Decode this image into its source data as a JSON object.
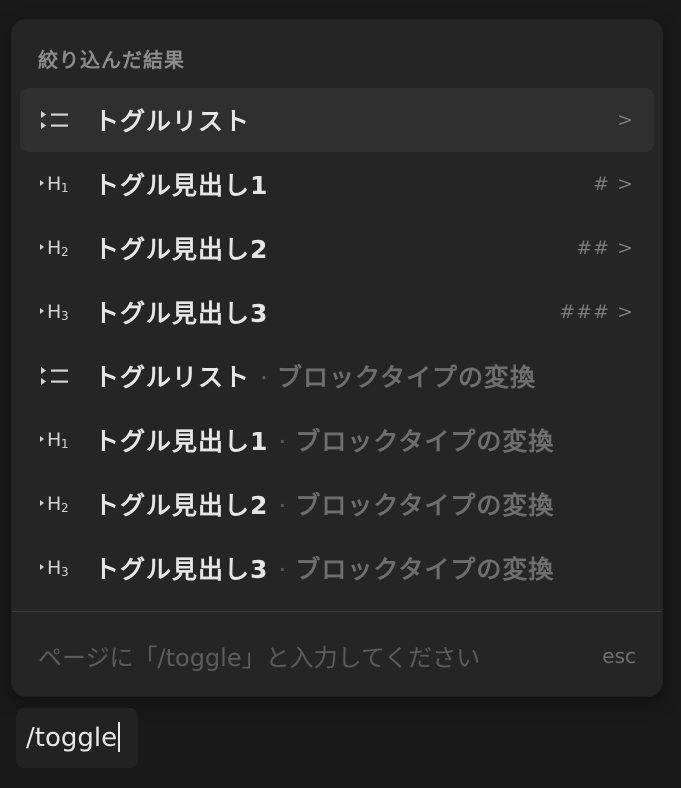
{
  "menu": {
    "header": "絞り込んだ結果",
    "items": [
      {
        "icon": "toggle-list-icon",
        "label": "トグルリスト",
        "sub": "",
        "shortcut": ">",
        "selected": true
      },
      {
        "icon": "toggle-heading-1-icon",
        "label": "トグル見出し1",
        "sub": "",
        "shortcut": "# >",
        "selected": false
      },
      {
        "icon": "toggle-heading-2-icon",
        "label": "トグル見出し2",
        "sub": "",
        "shortcut": "## >",
        "selected": false
      },
      {
        "icon": "toggle-heading-3-icon",
        "label": "トグル見出し3",
        "sub": "",
        "shortcut": "### >",
        "selected": false
      },
      {
        "icon": "toggle-list-icon",
        "label": "トグルリスト",
        "sub": "ブロックタイプの変換",
        "shortcut": "",
        "selected": false
      },
      {
        "icon": "toggle-heading-1-icon",
        "label": "トグル見出し1",
        "sub": "ブロックタイプの変換",
        "shortcut": "",
        "selected": false
      },
      {
        "icon": "toggle-heading-2-icon",
        "label": "トグル見出し2",
        "sub": "ブロックタイプの変換",
        "shortcut": "",
        "selected": false
      },
      {
        "icon": "toggle-heading-3-icon",
        "label": "トグル見出し3",
        "sub": "ブロックタイプの変換",
        "shortcut": "",
        "selected": false
      }
    ],
    "separator": "·",
    "footer": {
      "hint": "ページに「/toggle」と入力してください",
      "esc": "esc"
    }
  },
  "editor": {
    "input_value": "/toggle"
  },
  "colors": {
    "background": "#191919",
    "menu_bg": "#252525",
    "selected_bg": "#2f2f2f"
  }
}
